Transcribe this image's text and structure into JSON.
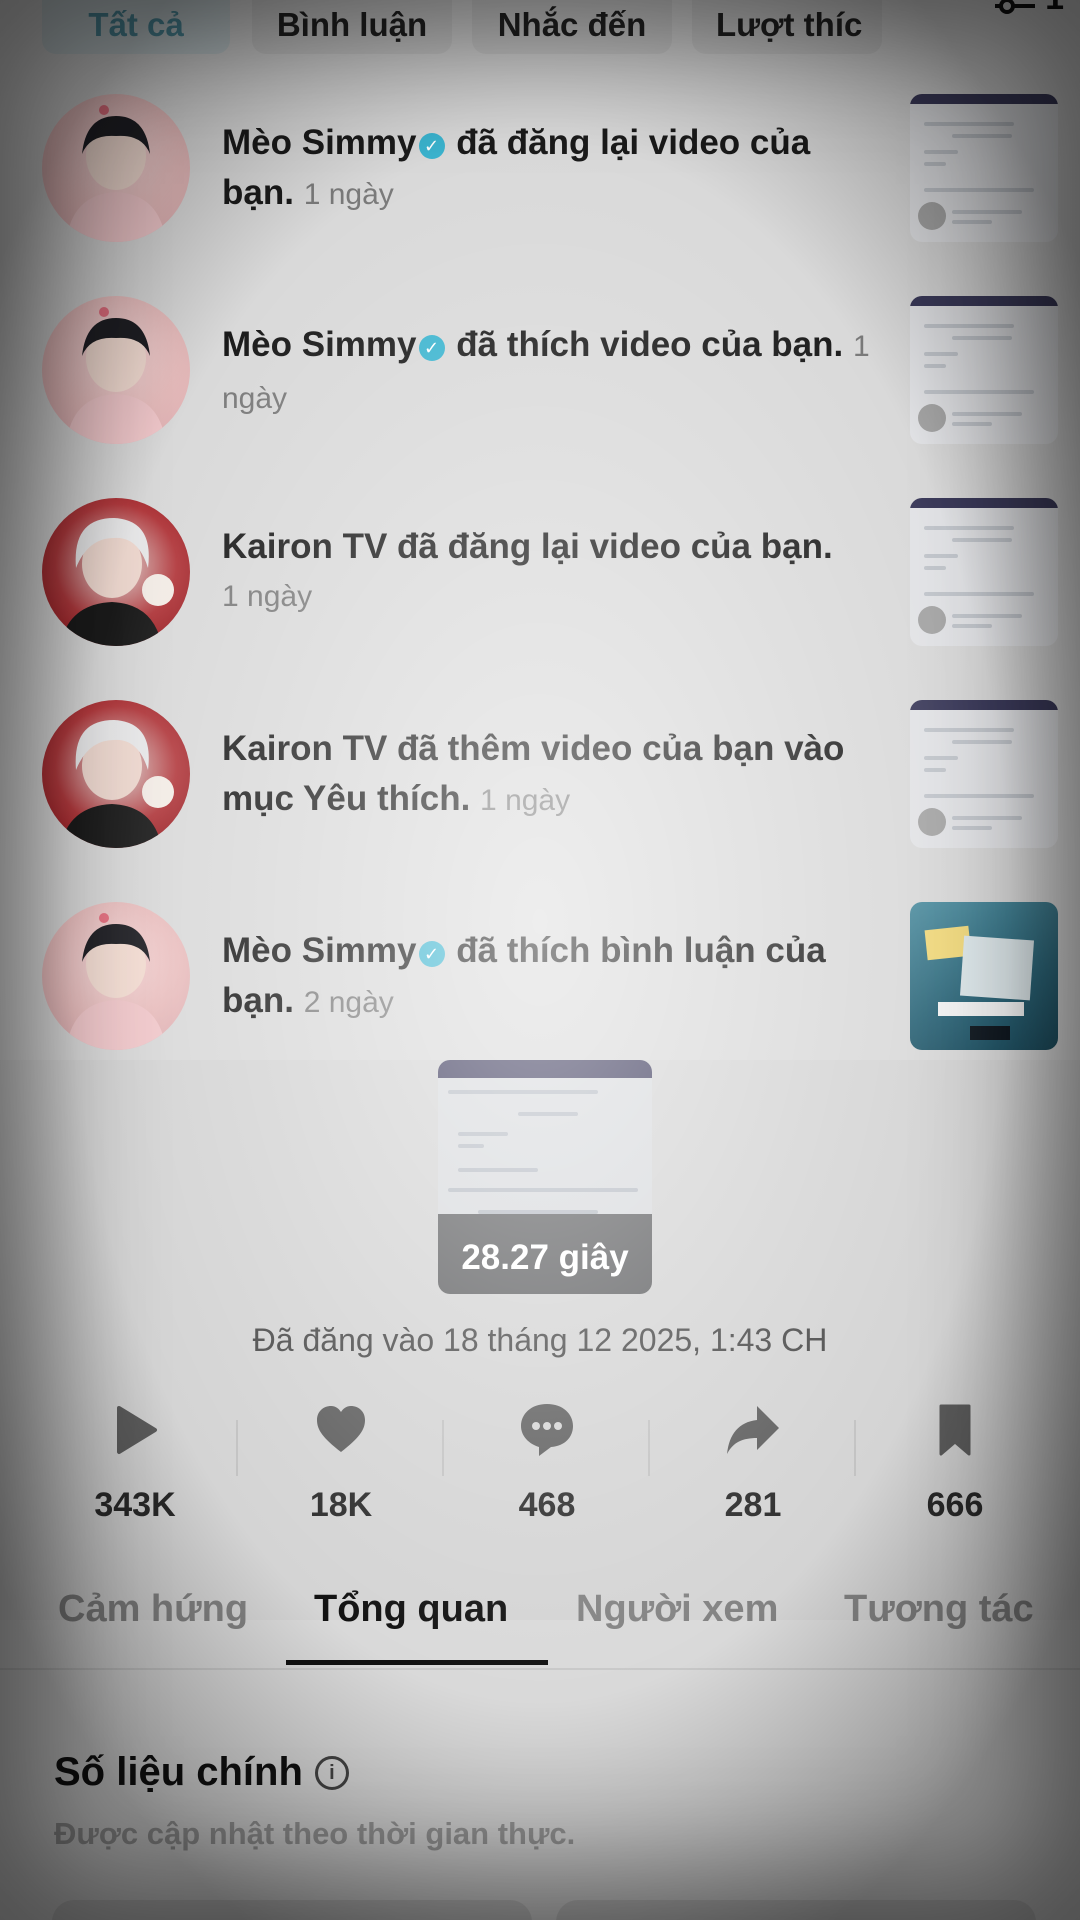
{
  "filters": {
    "items": [
      "Tất cả",
      "Bình luận",
      "Nhắc đến",
      "Lượt thíc"
    ],
    "active_index": 0,
    "filter_count": "1"
  },
  "notifications": [
    {
      "actor": "Mèo Simmy",
      "verified": true,
      "action": "đã đăng lại video của bạn.",
      "time": "1 ngày",
      "avatar": "pink"
    },
    {
      "actor": "Mèo Simmy",
      "verified": true,
      "action": "đã thích video của bạn.",
      "time": "1 ngày",
      "avatar": "pink"
    },
    {
      "actor": "Kairon TV",
      "verified": false,
      "action": "đã đăng lại video của bạn.",
      "time": "1 ngày",
      "avatar": "red"
    },
    {
      "actor": "Kairon TV",
      "verified": false,
      "action": "đã thêm video của bạn vào mục Yêu thích.",
      "time": "1 ngày",
      "avatar": "red"
    },
    {
      "actor": "Mèo Simmy",
      "verified": true,
      "action": "đã thích bình luận của bạn.",
      "time": "2 ngày",
      "avatar": "pink"
    }
  ],
  "video": {
    "duration": "28.27 giây",
    "posted": "Đã đăng vào 18 tháng 12 2025, 1:43 CH"
  },
  "stats": [
    {
      "icon": "play-icon",
      "value": "343K"
    },
    {
      "icon": "heart-icon",
      "value": "18K"
    },
    {
      "icon": "comment-icon",
      "value": "468"
    },
    {
      "icon": "share-icon",
      "value": "281"
    },
    {
      "icon": "bookmark-icon",
      "value": "666"
    }
  ],
  "tabs": [
    "Cảm hứng",
    "Tổng quan",
    "Người xem",
    "Tương tác"
  ],
  "active_tab": "Tổng quan",
  "metrics": {
    "title": "Số liệu chính",
    "subtitle": "Được cập nhật theo thời gian thực."
  },
  "colors": {
    "verified": "#3bb4cf",
    "active_filter_text": "#4f8fa0",
    "background": "#d9d9d9"
  }
}
